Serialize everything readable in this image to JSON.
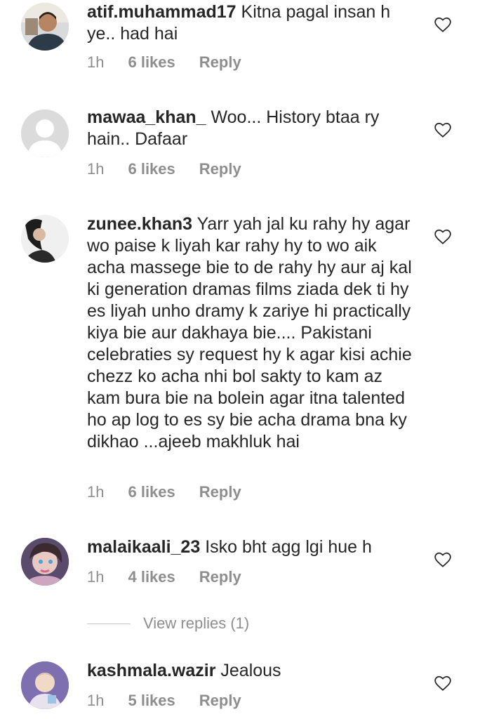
{
  "comments": [
    {
      "username": "atif.muhammad17",
      "text": "Kitna pagal insan h ye.. had hai",
      "time": "1h",
      "likes": "6 likes",
      "reply": "Reply"
    },
    {
      "username": "mawaa_khan_",
      "text": "Woo... History btaa ry hain.. Dafaar",
      "time": "1h",
      "likes": "6 likes",
      "reply": "Reply"
    },
    {
      "username": "zunee.khan3",
      "text": "Yarr yah jal ku rahy hy agar wo paise k liyah kar rahy hy to wo aik acha massege bie to de rahy hy aur aj kal ki generation dramas films ziada dek ti hy es liyah unho dramy k zariye hi practically kiya bie aur dakhaya bie.... Pakistani celebraties sy request hy k agar kisi achie chezz ko acha nhi bol sakty to kam az kam bura bie na bolein agar itna talented ho ap log to es sy bie acha drama bna ky dikhao ...ajeeb makhluk hai",
      "time": "1h",
      "likes": "6 likes",
      "reply": "Reply"
    },
    {
      "username": "malaikaali_23",
      "text": "Isko bht agg lgi hue h",
      "time": "1h",
      "likes": "4 likes",
      "reply": "Reply"
    },
    {
      "username": "kashmala.wazir",
      "text": "Jealous",
      "time": "1h",
      "likes": "5 likes",
      "reply": "Reply"
    }
  ],
  "view_replies": "View replies (1)",
  "icons": {
    "like": "heart-outline-icon"
  },
  "colors": {
    "text": "#262626",
    "meta": "#8e8e8e"
  }
}
